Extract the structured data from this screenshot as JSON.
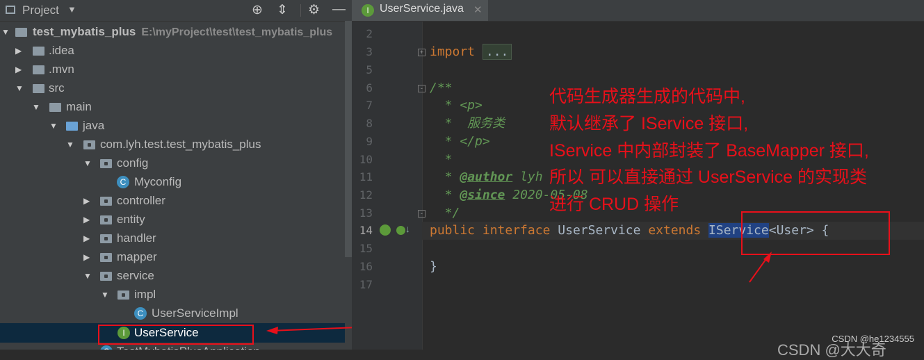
{
  "project_panel": {
    "title": "Project",
    "tree": [
      {
        "label": "test_mybatis_plus",
        "path": "E:\\myProject\\test\\test_mybatis_plus"
      },
      {
        "label": ".idea"
      },
      {
        "label": ".mvn"
      },
      {
        "label": "src"
      },
      {
        "label": "main"
      },
      {
        "label": "java"
      },
      {
        "label": "com.lyh.test.test_mybatis_plus"
      },
      {
        "label": "config"
      },
      {
        "label": "Myconfig"
      },
      {
        "label": "controller"
      },
      {
        "label": "entity"
      },
      {
        "label": "handler"
      },
      {
        "label": "mapper"
      },
      {
        "label": "service"
      },
      {
        "label": "impl"
      },
      {
        "label": "UserServiceImpl"
      },
      {
        "label": "UserService"
      },
      {
        "label": "TestMybatisPlusApplication"
      }
    ]
  },
  "editor": {
    "tab_label": "UserService.java",
    "line_numbers": [
      "2",
      "3",
      "5",
      "6",
      "7",
      "8",
      "9",
      "10",
      "11",
      "12",
      "13",
      "14",
      "15",
      "16",
      "17"
    ],
    "code": {
      "import_kw": "import",
      "import_dots": "...",
      "doc_open": "/**",
      "doc_p": "  * <p>",
      "doc_service": "  *  服务类",
      "doc_p_close": "  * </p>",
      "doc_star": "  *",
      "author_tag": "@author",
      "author_val": " lyh",
      "since_tag": "@since",
      "since_val": " 2020-05-08",
      "doc_close": "  */",
      "kw_public": "public",
      "kw_interface": "interface",
      "class_name": "UserService",
      "kw_extends": "extends",
      "iservice": "IService",
      "generic": "<User> {",
      "closing": "}"
    }
  },
  "annotation": {
    "lines": [
      "代码生成器生成的代码中,",
      "默认继承了 IService 接口,",
      "IService 中内部封装了 BaseMapper 接口,",
      "所以 可以直接通过 UserService 的实现类",
      "进行 CRUD 操作"
    ]
  },
  "watermark": "CSDN @he1234555",
  "watermark2": "CSDN @大大奇",
  "colors": {
    "annotation": "#e8101a",
    "selection": "#0d293e",
    "keyword": "#cc7832",
    "doc": "#629755"
  }
}
